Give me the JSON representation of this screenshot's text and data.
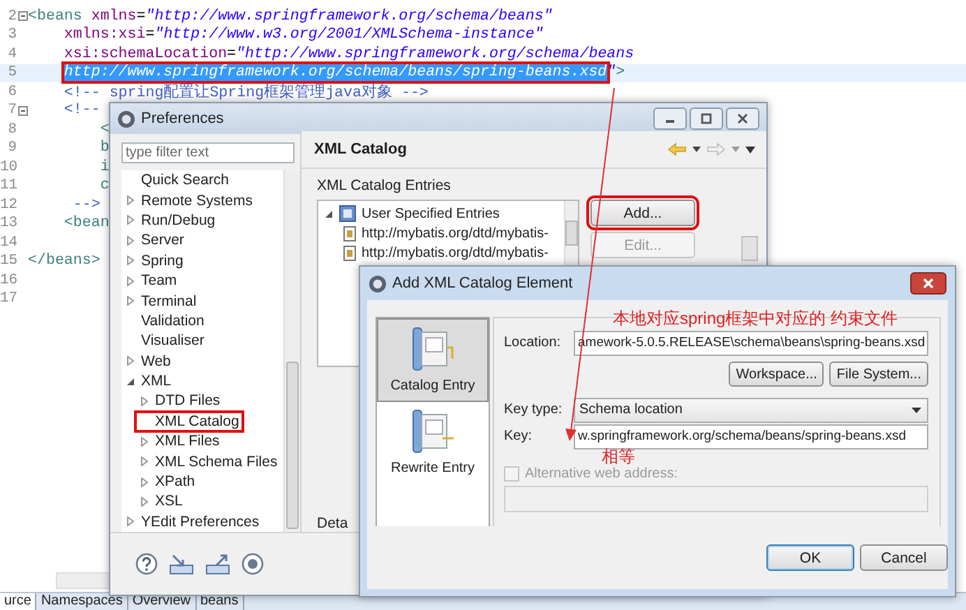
{
  "editor": {
    "lines": [
      {
        "number": "2",
        "collapsible": true,
        "selected": false,
        "segments": [
          {
            "kind": "tag",
            "text": "<beans"
          },
          {
            "kind": "attr",
            "text": " xmlns"
          },
          {
            "kind": "punct",
            "text": "="
          },
          {
            "kind": "value",
            "text": "\"http://www.springframework.org/schema/beans\""
          }
        ]
      },
      {
        "number": "3",
        "collapsible": false,
        "selected": false,
        "segments": [
          {
            "kind": "attr",
            "text": "    xmlns:xsi"
          },
          {
            "kind": "punct",
            "text": "="
          },
          {
            "kind": "value",
            "text": "\"http://www.w3.org/2001/XMLSchema-instance\""
          }
        ]
      },
      {
        "number": "4",
        "collapsible": false,
        "selected": false,
        "segments": [
          {
            "kind": "attr",
            "text": "    xsi:schemaLocation"
          },
          {
            "kind": "punct",
            "text": "="
          },
          {
            "kind": "value",
            "text": "\"http://www.springframework.org/schema/beans"
          }
        ]
      },
      {
        "number": "5",
        "collapsible": false,
        "selected": true,
        "segments": [
          {
            "kind": "selection",
            "text": "http://www.springframework.org/schema/beans/spring-beans.xsd"
          },
          {
            "kind": "value",
            "text": "\""
          },
          {
            "kind": "tag",
            "text": ">"
          }
        ]
      },
      {
        "number": "6",
        "collapsible": false,
        "selected": false,
        "segments": [
          {
            "kind": "comment",
            "text": "    <!-- spring配置让Spring框架管理java对象 -->"
          }
        ]
      },
      {
        "number": "7",
        "collapsible": true,
        "selected": false,
        "segments": [
          {
            "kind": "comment",
            "text": "    <!--"
          }
        ]
      },
      {
        "number": "8",
        "collapsible": false,
        "selected": false,
        "segments": [
          {
            "kind": "tag",
            "text": "        <"
          }
        ]
      },
      {
        "number": "9",
        "collapsible": false,
        "selected": false,
        "segments": [
          {
            "kind": "tag",
            "text": "        b"
          }
        ]
      },
      {
        "number": "10",
        "collapsible": false,
        "selected": false,
        "segments": [
          {
            "kind": "tag",
            "text": "        i"
          }
        ]
      },
      {
        "number": "11",
        "collapsible": false,
        "selected": false,
        "segments": [
          {
            "kind": "tag",
            "text": "        c"
          }
        ]
      },
      {
        "number": "12",
        "collapsible": false,
        "selected": false,
        "segments": [
          {
            "kind": "comment",
            "text": "     -->"
          }
        ]
      },
      {
        "number": "13",
        "collapsible": false,
        "selected": false,
        "segments": [
          {
            "kind": "tag",
            "text": "    <bean"
          }
        ]
      },
      {
        "number": "14",
        "collapsible": false,
        "selected": false
      },
      {
        "number": "15",
        "collapsible": false,
        "selected": false,
        "segments": [
          {
            "kind": "tag",
            "text": "</beans>"
          }
        ]
      },
      {
        "number": "16",
        "collapsible": false,
        "selected": false
      },
      {
        "number": "17",
        "collapsible": false,
        "selected": false
      }
    ],
    "tabs": [
      {
        "label": "urce",
        "selected": true
      },
      {
        "label": "Namespaces",
        "selected": false
      },
      {
        "label": "Overview",
        "selected": false
      },
      {
        "label": "beans",
        "selected": false
      }
    ]
  },
  "preferences": {
    "title": "Preferences",
    "filter": {
      "placeholder": "type filter text"
    },
    "tree": [
      {
        "label": "Quick Search",
        "has_children": false,
        "selected": false
      },
      {
        "label": "Remote Systems",
        "has_children": true,
        "expanded": false,
        "selected": false
      },
      {
        "label": "Run/Debug",
        "has_children": true,
        "expanded": false,
        "selected": false
      },
      {
        "label": "Server",
        "has_children": true,
        "expanded": false,
        "selected": false
      },
      {
        "label": "Spring",
        "has_children": true,
        "expanded": false,
        "selected": false
      },
      {
        "label": "Team",
        "has_children": true,
        "expanded": false,
        "selected": false
      },
      {
        "label": "Terminal",
        "has_children": true,
        "expanded": false,
        "selected": false
      },
      {
        "label": "Validation",
        "has_children": false,
        "selected": false
      },
      {
        "label": "Visualiser",
        "has_children": false,
        "selected": false
      },
      {
        "label": "Web",
        "has_children": true,
        "expanded": false,
        "selected": false
      },
      {
        "label": "XML",
        "has_children": true,
        "expanded": true,
        "selected": false,
        "children": [
          {
            "label": "DTD Files",
            "has_children": true,
            "expanded": false,
            "selected": false
          },
          {
            "label": "XML Catalog",
            "has_children": false,
            "selected": true
          },
          {
            "label": "XML Files",
            "has_children": true,
            "expanded": false,
            "selected": false
          },
          {
            "label": "XML Schema Files",
            "has_children": true,
            "expanded": false,
            "selected": false
          },
          {
            "label": "XPath",
            "has_children": true,
            "expanded": false,
            "selected": false
          },
          {
            "label": "XSL",
            "has_children": true,
            "expanded": false,
            "selected": false
          }
        ]
      },
      {
        "label": "YEdit Preferences",
        "has_children": true,
        "expanded": false,
        "selected": false
      }
    ],
    "page_title": "XML Catalog",
    "group_label": "XML Catalog Entries",
    "entries": [
      {
        "label": "User Specified Entries",
        "expanded": true,
        "children": [
          {
            "label": "http://mybatis.org/dtd/mybatis-"
          },
          {
            "label": "http://mybatis.org/dtd/mybatis-"
          }
        ]
      }
    ],
    "buttons": [
      {
        "label": "Add...",
        "disabled": false,
        "marked": true
      },
      {
        "label": "Edit...",
        "disabled": true,
        "marked": false
      }
    ],
    "details_label": "Deta"
  },
  "dialog": {
    "title": "Add XML Catalog Element",
    "entry_types": [
      {
        "label": "Catalog Entry",
        "selected": true
      },
      {
        "label": "Rewrite Entry",
        "selected": false
      }
    ],
    "note_top": "本地对应spring框架中对应的 约束文件",
    "location": {
      "label": "Location:",
      "value": "amework-5.0.5.RELEASE\\schema\\beans\\spring-beans.xsd"
    },
    "browse_buttons": [
      "Workspace...",
      "File System..."
    ],
    "key_type": {
      "label": "Key type:",
      "value": "Schema location"
    },
    "key": {
      "label": "Key:",
      "value": "w.springframework.org/schema/beans/spring-beans.xsd"
    },
    "note_bottom": "相等",
    "alternative": {
      "label": "Alternative web address:",
      "checked": false,
      "disabled": true
    },
    "buttons": [
      {
        "label": "OK",
        "default": true
      },
      {
        "label": "Cancel",
        "default": false
      }
    ]
  }
}
